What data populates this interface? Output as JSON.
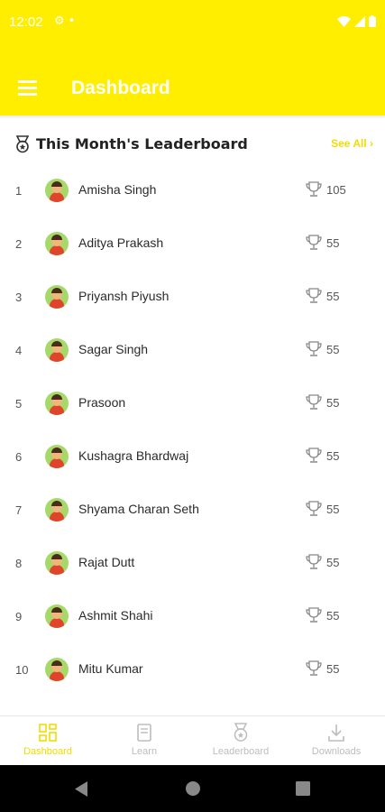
{
  "status_bar": {
    "time": "12:02",
    "bg_color": "#ffee00"
  },
  "app_bar": {
    "title": "Dashboard",
    "menu_icon": "hamburger-menu-icon"
  },
  "leaderboard": {
    "title": "This Month's Leaderboard",
    "see_all": "See All",
    "icon": "leaderboard-medal-icon",
    "rows": [
      {
        "rank": "1",
        "name": "Amisha Singh",
        "points": "105"
      },
      {
        "rank": "2",
        "name": "Aditya Prakash",
        "points": "55"
      },
      {
        "rank": "3",
        "name": "Priyansh Piyush",
        "points": "55"
      },
      {
        "rank": "4",
        "name": "Sagar Singh",
        "points": "55"
      },
      {
        "rank": "5",
        "name": "Prasoon",
        "points": "55"
      },
      {
        "rank": "6",
        "name": "Kushagra Bhardwaj",
        "points": "55"
      },
      {
        "rank": "7",
        "name": "Shyama Charan Seth",
        "points": "55"
      },
      {
        "rank": "8",
        "name": "Rajat Dutt",
        "points": "55"
      },
      {
        "rank": "9",
        "name": "Ashmit Shahi",
        "points": "55"
      },
      {
        "rank": "10",
        "name": "Mitu Kumar",
        "points": "55"
      }
    ]
  },
  "bottom_nav": {
    "items": [
      {
        "label": "Dashboard",
        "icon": "dashboard-grid-icon",
        "active": true
      },
      {
        "label": "Learn",
        "icon": "book-icon",
        "active": false
      },
      {
        "label": "Leaderboard",
        "icon": "medal-icon",
        "active": false
      },
      {
        "label": "Downloads",
        "icon": "download-icon",
        "active": false
      }
    ]
  },
  "colors": {
    "accent": "#ffee00",
    "accent_text": "#f2dc00",
    "nav_inactive": "#bdbdbd"
  }
}
